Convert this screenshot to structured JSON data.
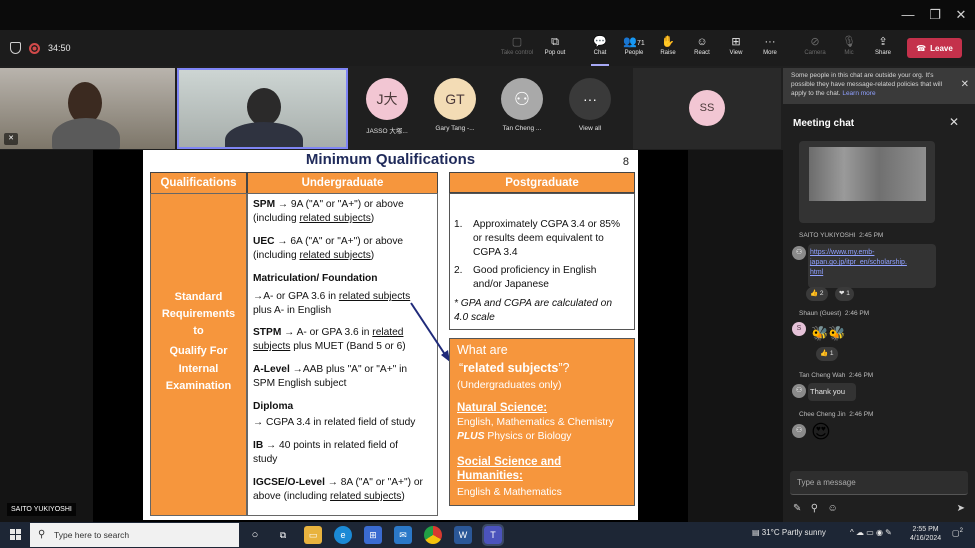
{
  "colors": {
    "accent": "#7f85f5",
    "leave": "#c4314b",
    "slide_orange": "#f6963d",
    "slide_title": "#1f2a5a"
  },
  "meeting": {
    "timer": "34:50",
    "toolbar": [
      {
        "label": "Take control",
        "icon": "take-control-icon",
        "enabled": false
      },
      {
        "label": "Pop out",
        "icon": "pop-out-icon",
        "enabled": true
      },
      {
        "label": "Chat",
        "icon": "chat-icon",
        "enabled": true,
        "active": true
      },
      {
        "label": "People",
        "icon": "people-icon",
        "count": "71",
        "enabled": true
      },
      {
        "label": "Raise",
        "icon": "raise-hand-icon",
        "enabled": true
      },
      {
        "label": "React",
        "icon": "react-icon",
        "enabled": true
      },
      {
        "label": "View",
        "icon": "view-icon",
        "enabled": true
      },
      {
        "label": "More",
        "icon": "more-icon",
        "enabled": true
      },
      {
        "label": "Camera",
        "icon": "camera-off-icon",
        "enabled": false
      },
      {
        "label": "Mic",
        "icon": "mic-off-icon",
        "enabled": false
      },
      {
        "label": "Share",
        "icon": "share-icon",
        "enabled": true
      }
    ],
    "leave_label": "Leave"
  },
  "participants": [
    {
      "initials": "J大",
      "name": "JASSO 大塚...",
      "color": "#f2c6d3"
    },
    {
      "initials": "GT",
      "name": "Gary Tang -...",
      "color": "#f3dcb5"
    },
    {
      "initials": "",
      "name": "Tan Cheng ...",
      "color": "#a9a9a9"
    },
    {
      "initials": "···",
      "name": "View all",
      "color": "#3a3a3a"
    }
  ],
  "ss_tile": {
    "initials": "SS"
  },
  "presenter_label": "SAITO YUKIYOSHI",
  "slide": {
    "title": "Minimum Qualifications",
    "number": "8",
    "headers": {
      "qualifications": "Qualifications",
      "undergraduate": "Undergraduate",
      "postgraduate": "Postgraduate"
    },
    "requirements": [
      "Standard",
      "Requirements",
      "to",
      "Qualify For",
      "Internal",
      "Examination"
    ],
    "undergrad_lines": [
      {
        "b": "SPM",
        "t": " → 9A (\"A\" or \"A+\") or above"
      },
      {
        "t": "(including ",
        "u": "related subjects",
        "e": ")"
      },
      {
        "b": "UEC",
        "t": " → 6A (\"A\" or \"A+\") or above"
      },
      {
        "t": "(including ",
        "u": "related subjects",
        "e": ")"
      },
      {
        "b": "Matriculation/ Foundation",
        "t": ""
      },
      {
        "t": "→A- or GPA 3.6 in ",
        "u": "related subjects",
        "e": ""
      },
      {
        "t": "plus A- in English"
      },
      {
        "b": "STPM",
        "t": " → A- or GPA 3.6 in ",
        "u": "related",
        "e": ""
      },
      {
        "t": "",
        "u": "subjects",
        "e": " plus MUET (Band 5 or 6)"
      },
      {
        "b": "A-Level",
        "t": " →AAB plus \"A\" or \"A+\" in"
      },
      {
        "t": "SPM English subject"
      },
      {
        "b": "Diploma",
        "t": ""
      },
      {
        "t": "→ CGPA 3.4 in related field of study"
      },
      {
        "b": "IB",
        "t": " → 40 points in related field of"
      },
      {
        "t": "study"
      },
      {
        "b": "IGCSE/O-Level",
        "t": " → 8A (\"A\" or \"A+\") or"
      },
      {
        "t": "above (including ",
        "u": "related subjects",
        "e": ")"
      }
    ],
    "postgrad": {
      "item1": [
        "1.",
        "Approximately CGPA 3.4 or 85%",
        "or results deem equivalent to",
        "CGPA 3.4"
      ],
      "item2": [
        "2.",
        "Good proficiency in English",
        "and/or Japanese"
      ],
      "note": [
        "* GPA and CGPA are calculated on",
        "4.0 scale"
      ]
    },
    "related": {
      "q1": "What are",
      "q2_open": "“",
      "q2_bold": "related subjects",
      "q2_close": "”?",
      "sub": "(Undergraduates only)",
      "ns_title": "Natural Science:",
      "ns_line1": "English, Mathematics & Chemistry",
      "ns_plus": "PLUS",
      "ns_line2": " Physics or Biology",
      "ss_title1": "Social Science and",
      "ss_title2": "Humanities:",
      "ss_line": "English & Mathematics"
    }
  },
  "chat": {
    "notice": "Some people in this chat are outside your org. It's possible they have message-related policies that will apply to the chat.",
    "notice_link": "Learn more",
    "title": "Meeting chat",
    "messages": [
      {
        "sender": "SAITO YUKIYOSHI",
        "time": "2:45 PM",
        "link_lines": [
          "https://www.my.emb-",
          "japan.go.jp/itpr_en/scholarship.",
          "html"
        ],
        "reactions": [
          "👍 2",
          "❤ 1"
        ]
      },
      {
        "sender": "Shaun (Guest)",
        "time": "2:46 PM",
        "avatar": "S",
        "reactions": [
          "👍 1"
        ]
      },
      {
        "sender": "Tan Cheng Wah",
        "time": "2:46 PM",
        "text": "Thank you"
      },
      {
        "sender": "Chee Cheng Jin",
        "time": "2:46 PM"
      }
    ],
    "compose_placeholder": "Type a message"
  },
  "taskbar": {
    "search_placeholder": "Type here to search",
    "weather": "31°C  Partly sunny",
    "time": "2:55 PM",
    "date": "4/16/2024",
    "notifications": "2"
  }
}
